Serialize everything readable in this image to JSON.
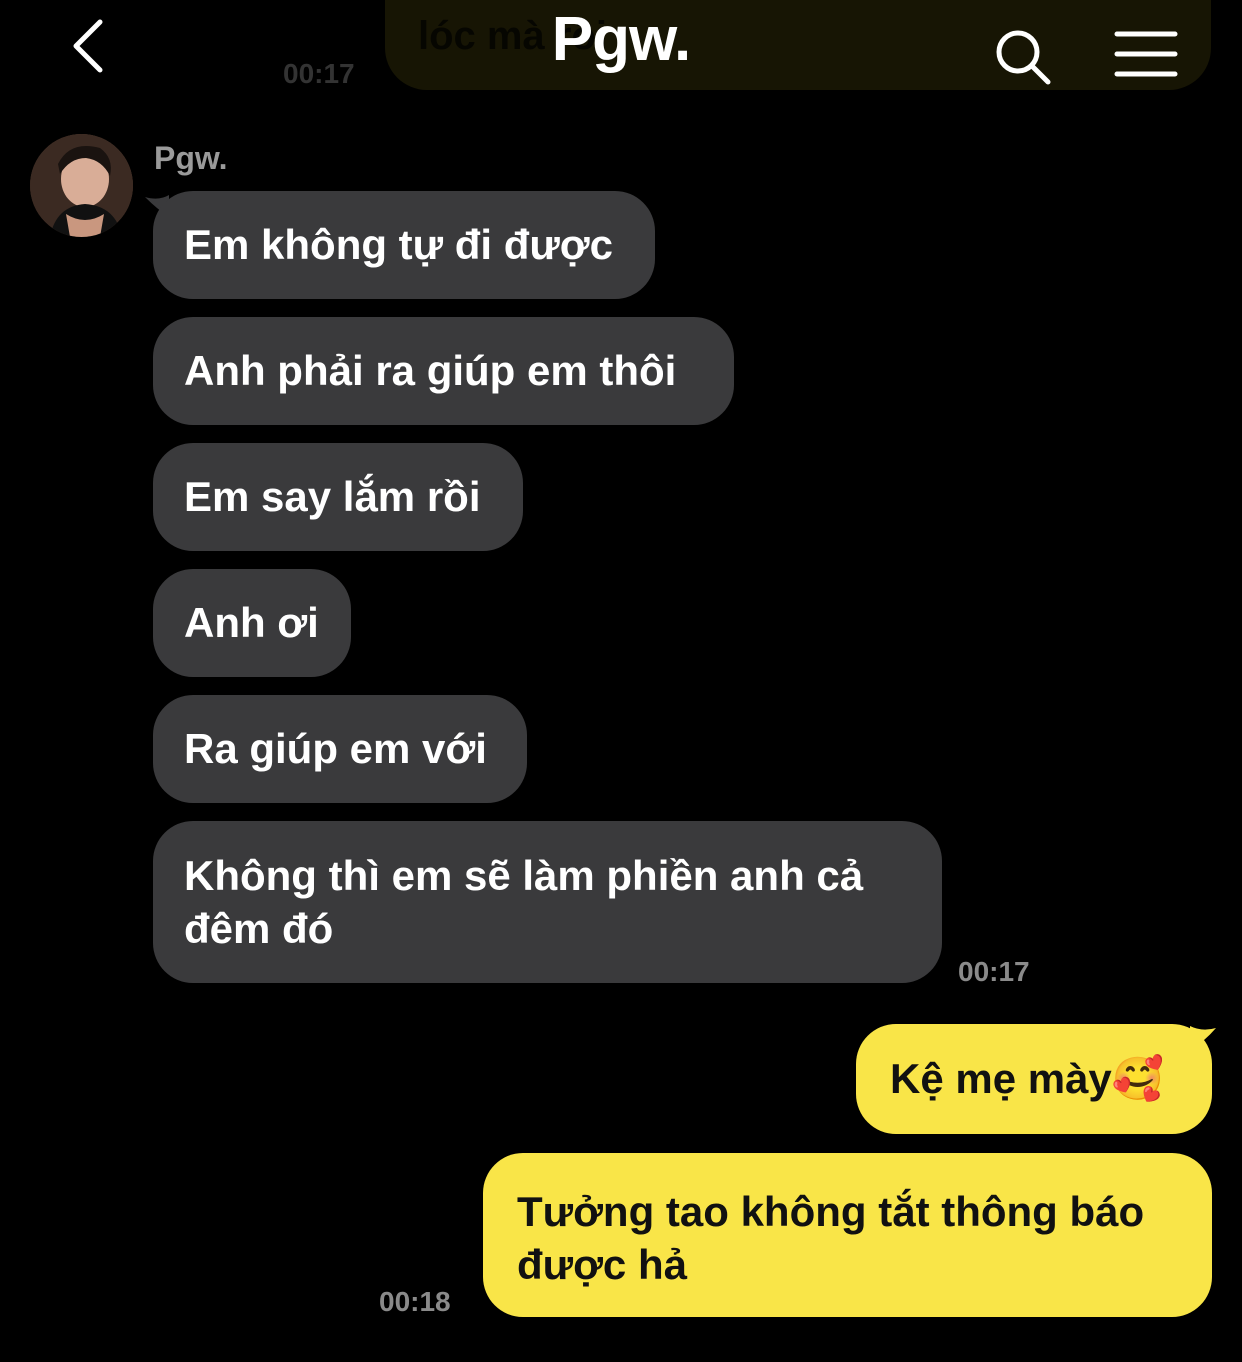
{
  "header": {
    "title": "Pgw.",
    "back_icon": "chevron-left-icon",
    "search_icon": "search-icon",
    "menu_icon": "hamburger-menu-icon"
  },
  "previous_message": {
    "partial_text": "lóc mà rồi",
    "time": "00:17"
  },
  "sender": {
    "name": "Pgw."
  },
  "messages_incoming": [
    {
      "text": "Em không tự đi được"
    },
    {
      "text": "Anh phải ra giúp em thôi"
    },
    {
      "text": "Em say lắm rồi"
    },
    {
      "text": "Anh ơi"
    },
    {
      "text": "Ra giúp em với"
    },
    {
      "text": "Không thì em sẽ làm phiền anh cả đêm đó"
    }
  ],
  "incoming_time": "00:17",
  "messages_outgoing": [
    {
      "text": "Kệ mẹ mày🥰"
    },
    {
      "text": "Tưởng tao không tắt thông báo được hả"
    }
  ],
  "outgoing_time": "00:18",
  "colors": {
    "background": "#000000",
    "incoming_bubble": "#3a3a3c",
    "outgoing_bubble": "#f9e548",
    "timestamp": "#8a8a8a"
  }
}
